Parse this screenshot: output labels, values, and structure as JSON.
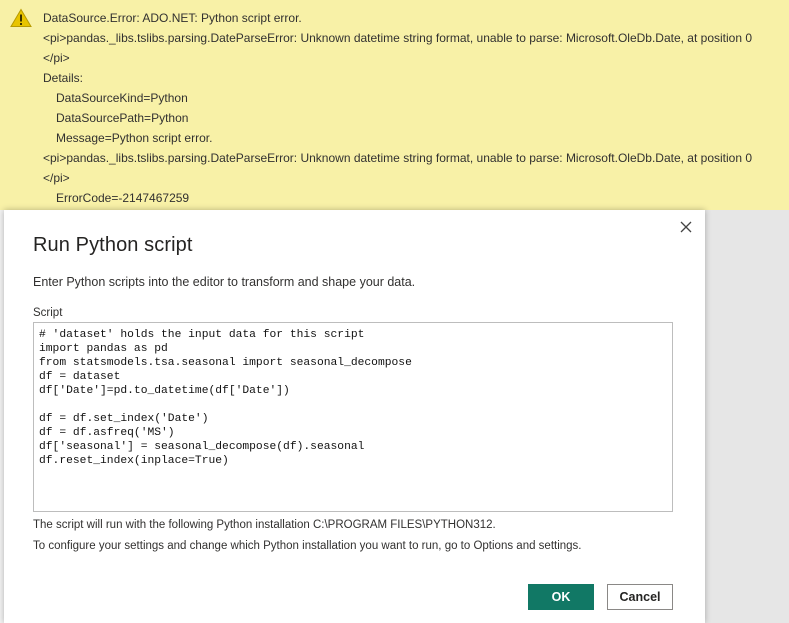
{
  "error": {
    "lines": [
      "DataSource.Error: ADO.NET: Python script error.",
      "<pi>pandas._libs.tslibs.parsing.DateParseError: Unknown datetime string format, unable to parse: Microsoft.OleDb.Date, at position 0",
      "</pi>",
      "Details:",
      "DataSourceKind=Python",
      "DataSourcePath=Python",
      "Message=Python script error.",
      "<pi>pandas._libs.tslibs.parsing.DateParseError: Unknown datetime string format, unable to parse: Microsoft.OleDb.Date, at position 0",
      "</pi>",
      "ErrorCode=-2147467259"
    ],
    "colors": {
      "banner": "#f8f1a7",
      "icon": "#c8a800"
    }
  },
  "dialog": {
    "title": "Run Python script",
    "description": "Enter Python scripts into the editor to transform and shape your data.",
    "script_label": "Script",
    "code_lines": [
      "# 'dataset' holds the input data for this script",
      "import pandas as pd",
      "from statsmodels.tsa.seasonal import seasonal_decompose",
      "df = dataset",
      "df['Date']=pd.to_datetime(df['Date'])",
      "",
      "df = df.set_index('Date')",
      "df = df.asfreq('MS')",
      "df['seasonal'] = seasonal_decompose(df).seasonal",
      "df.reset_index(inplace=True)"
    ],
    "note_installation": "The script will run with the following Python installation C:\\PROGRAM FILES\\PYTHON312.",
    "note_settings": "To configure your settings and change which Python installation you want to run, go to Options and settings.",
    "ok_label": "OK",
    "cancel_label": "Cancel",
    "colors": {
      "ok_button": "#117865"
    }
  }
}
